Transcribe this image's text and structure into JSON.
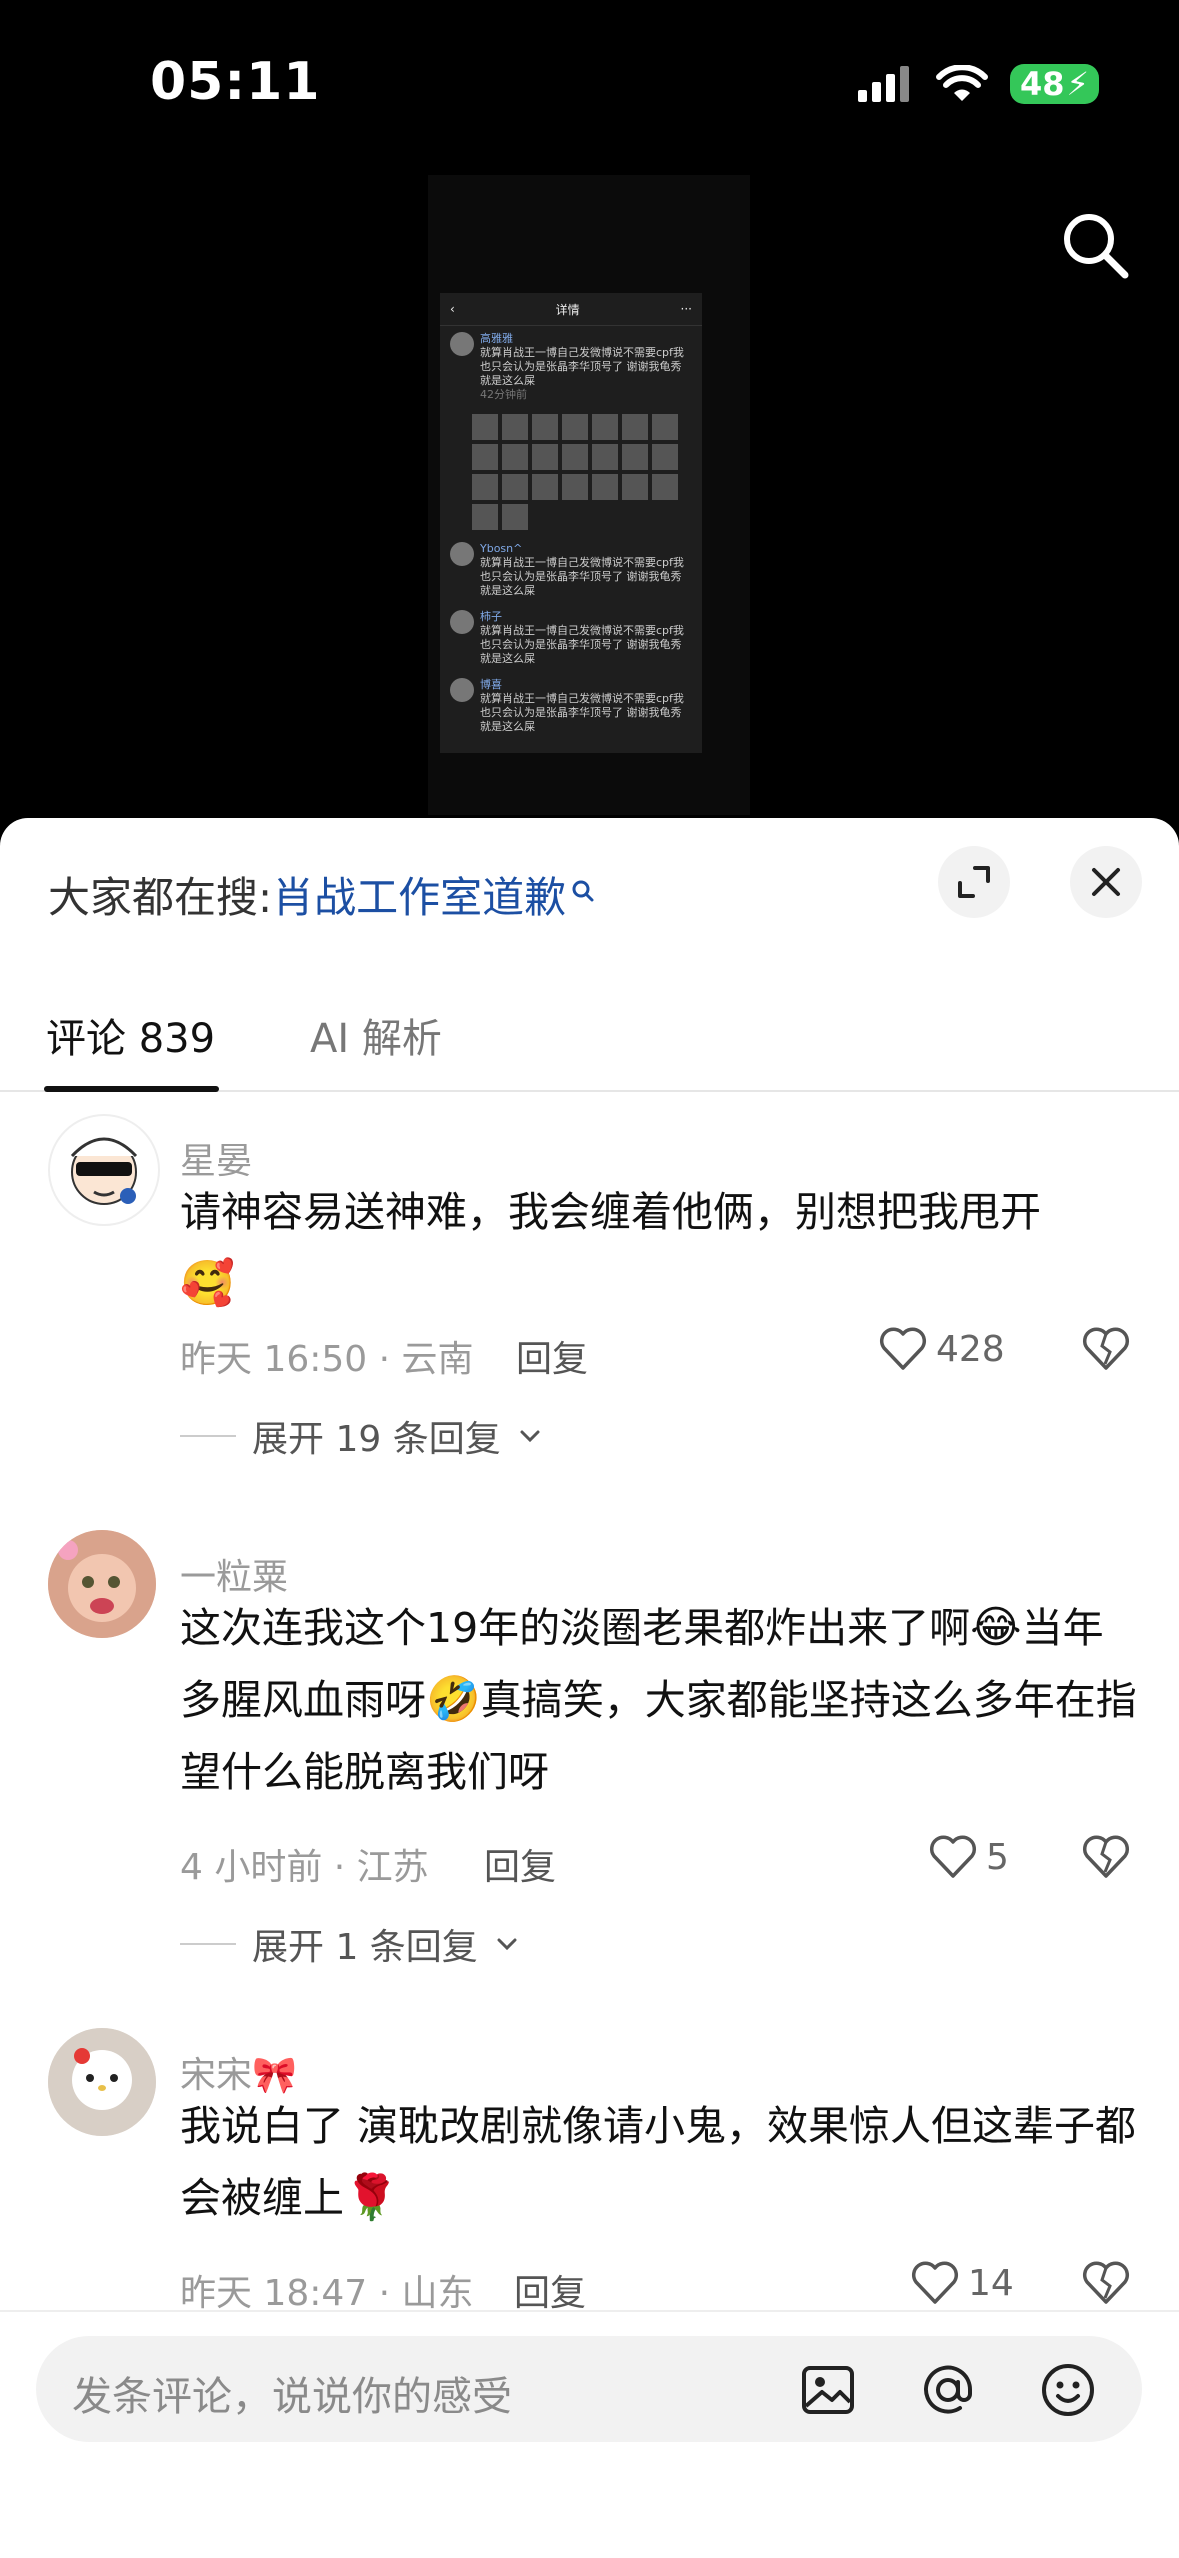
{
  "status_bar": {
    "time": "05:11",
    "battery": "48"
  },
  "sheet": {
    "trending_prefix": "大家都在搜:",
    "trending_keyword": "肖战工作室道歉",
    "tabs": [
      {
        "label": "评论 839"
      },
      {
        "label": "AI 解析"
      }
    ]
  },
  "video_thumb": {
    "header": "详情",
    "user": "高雅雅",
    "text": "就算肖战王一博自己发微博说不需要cpf我也只会认为是张晶李华顶号了 谢谢我龟秀就是这么屎",
    "time": "42分钟前",
    "sub1_name": "Ybosn^",
    "sub2_name": "柿子",
    "sub3_name": "博喜"
  },
  "comments": [
    {
      "name": "星晏",
      "text": "请神容易送神难，我会缠着他俩，别想把我甩开",
      "meta": "昨天 16:50 · 云南",
      "reply": "回复",
      "likes": "428",
      "expand": "展开 19 条回复"
    },
    {
      "name": "一粒粟",
      "text_a": "这次连我这个19年的淡圈老果都炸出来了啊",
      "text_b": "当年多腥风血雨呀",
      "text_c": "真搞笑，大家都能坚持这么多年在指望什么能脱离我们呀",
      "meta": "4 小时前 · 江苏",
      "reply": "回复",
      "likes": "5",
      "expand": "展开 1 条回复"
    },
    {
      "name": "宋宋",
      "text": "我说白了 演耽改剧就像请小鬼，效果惊人但这辈子都会被缠上",
      "meta": "昨天 18:47 · 山东",
      "reply": "回复",
      "likes": "14"
    }
  ],
  "input": {
    "placeholder": "发条评论，说说你的感受"
  },
  "icons": [
    "search-icon",
    "expand-icon",
    "close-icon",
    "heart-icon",
    "broken-heart-icon",
    "chevron-down-icon",
    "image-icon",
    "at-icon",
    "emoji-icon"
  ]
}
